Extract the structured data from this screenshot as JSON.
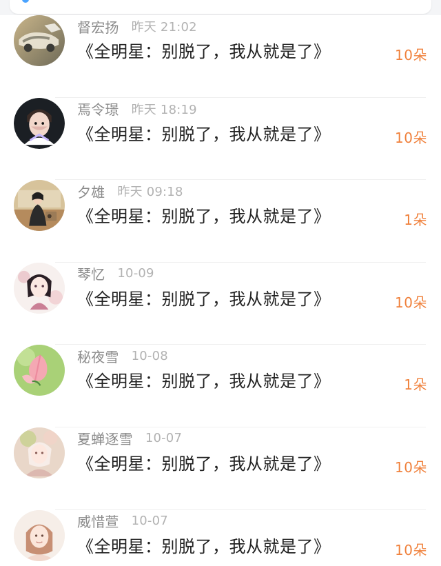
{
  "colors": {
    "background": "#ffffff",
    "name": "#8b8b8b",
    "time": "#b2b2b2",
    "message": "#222222",
    "gift": "#f0813c",
    "divider": "#efefef"
  },
  "messages": [
    {
      "name": "督宏扬",
      "time": "昨天 21:02",
      "message": "《全明星：别脱了，我从就是了》",
      "gift": "10朵",
      "avatar_icon": "vintage-car-avatar"
    },
    {
      "name": "焉令璟",
      "time": "昨天 18:19",
      "message": "《全明星：别脱了，我从就是了》",
      "gift": "10朵",
      "avatar_icon": "anime-boy-avatar"
    },
    {
      "name": "夕雄",
      "time": "昨天 09:18",
      "message": "《全明星：别脱了，我从就是了》",
      "gift": "1朵",
      "avatar_icon": "vintage-woman-avatar"
    },
    {
      "name": "琴忆",
      "time": "10-09",
      "message": "《全明星：别脱了，我从就是了》",
      "gift": "10朵",
      "avatar_icon": "anime-girl-avatar"
    },
    {
      "name": "秘夜雪",
      "time": "10-08",
      "message": "《全明星：别脱了，我从就是了》",
      "gift": "1朵",
      "avatar_icon": "lotus-avatar"
    },
    {
      "name": "夏蝉逐雪",
      "time": "10-07",
      "message": "《全明星：别脱了，我从就是了》",
      "gift": "10朵",
      "avatar_icon": "floral-girl-avatar"
    },
    {
      "name": "威惜萱",
      "time": "10-07",
      "message": "《全明星：别脱了，我从就是了》",
      "gift": "10朵",
      "avatar_icon": "portrait-girl-avatar"
    }
  ]
}
